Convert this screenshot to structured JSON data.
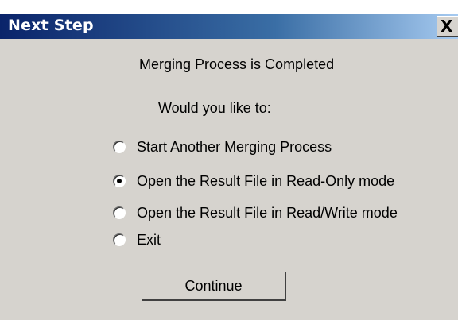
{
  "window": {
    "title": "Next Step",
    "close_label": "X"
  },
  "message": {
    "main": "Merging Process is Completed",
    "prompt": "Would you like to:"
  },
  "options": [
    {
      "label": "Start Another Merging Process",
      "selected": false
    },
    {
      "label": "Open the Result File in Read-Only mode",
      "selected": true
    },
    {
      "label": "Open the Result File in Read/Write mode",
      "selected": false
    },
    {
      "label": "Exit",
      "selected": false
    }
  ],
  "buttons": {
    "continue_label": "Continue"
  },
  "colors": {
    "dialog_bg": "#d6d3ce",
    "titlebar_start": "#0a246a",
    "titlebar_end": "#a6caf0"
  }
}
